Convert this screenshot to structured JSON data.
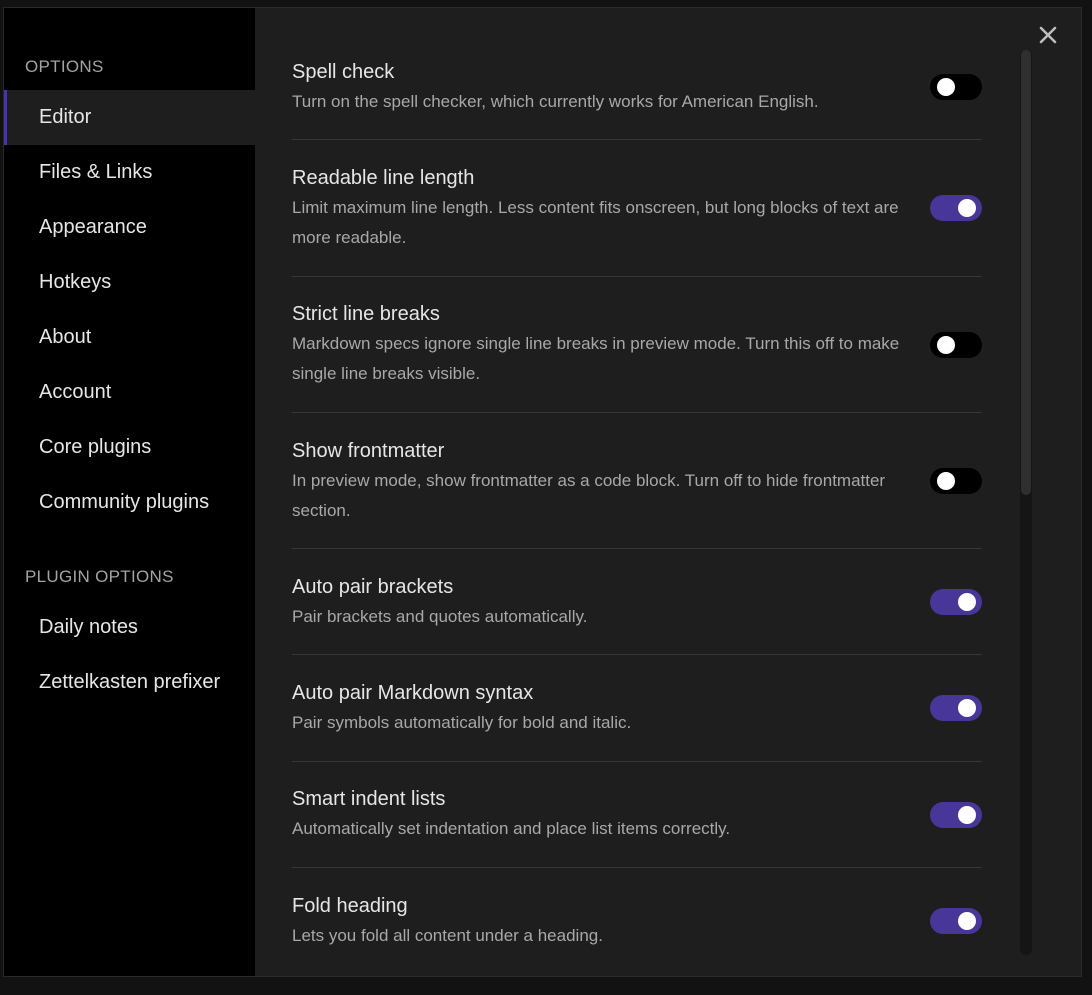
{
  "sidebar": {
    "options_heading": "OPTIONS",
    "items": [
      {
        "label": "Editor",
        "active": true
      },
      {
        "label": "Files & Links"
      },
      {
        "label": "Appearance"
      },
      {
        "label": "Hotkeys"
      },
      {
        "label": "About"
      },
      {
        "label": "Account"
      },
      {
        "label": "Core plugins"
      },
      {
        "label": "Community plugins"
      }
    ],
    "plugin_heading": "PLUGIN OPTIONS",
    "plugin_items": [
      {
        "label": "Daily notes"
      },
      {
        "label": "Zettelkasten prefixer"
      }
    ]
  },
  "close_icon": "close-icon",
  "settings": [
    {
      "name": "Spell check",
      "desc": "Turn on the spell checker, which currently works for American English.",
      "enabled": false
    },
    {
      "name": "Readable line length",
      "desc": "Limit maximum line length. Less content fits onscreen, but long blocks of text are more readable.",
      "enabled": true
    },
    {
      "name": "Strict line breaks",
      "desc": "Markdown specs ignore single line breaks in preview mode. Turn this off to make single line breaks visible.",
      "enabled": false
    },
    {
      "name": "Show frontmatter",
      "desc": "In preview mode, show frontmatter as a code block. Turn off to hide frontmatter section.",
      "enabled": false
    },
    {
      "name": "Auto pair brackets",
      "desc": "Pair brackets and quotes automatically.",
      "enabled": true
    },
    {
      "name": "Auto pair Markdown syntax",
      "desc": "Pair symbols automatically for bold and italic.",
      "enabled": true
    },
    {
      "name": "Smart indent lists",
      "desc": "Automatically set indentation and place list items correctly.",
      "enabled": true
    },
    {
      "name": "Fold heading",
      "desc": "Lets you fold all content under a heading.",
      "enabled": true
    }
  ],
  "colors": {
    "accent": "#483699",
    "sidebar_bg": "#000000",
    "content_bg": "#1e1e1e"
  }
}
